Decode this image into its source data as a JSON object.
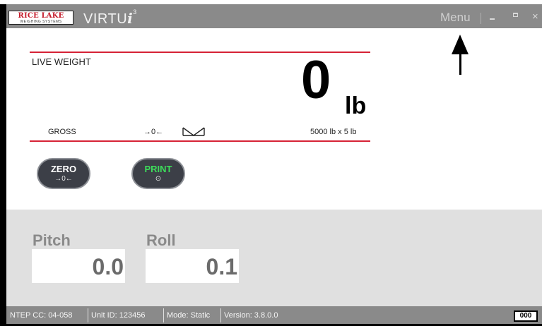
{
  "titlebar": {
    "logo_text": "RICE LAKE",
    "logo_subtext": "WEIGHING SYSTEMS",
    "brand_name": "VIRTU",
    "brand_i": "i",
    "brand_sup": "3",
    "menu_label": "Menu",
    "minimize_glyph": "minimize-icon",
    "maximize_glyph": "maximize-icon",
    "close_glyph": "×"
  },
  "live_weight": {
    "label": "LIVE WEIGHT",
    "value": "0",
    "unit": "lb",
    "mode": "GROSS",
    "center_of_zero_glyph": "→0←",
    "capacity": "5000 lb x 5 lb"
  },
  "buttons": {
    "zero": {
      "label": "ZERO",
      "icon_text": "→0←"
    },
    "print": {
      "label": "PRINT",
      "icon_text": "⊙"
    }
  },
  "tilt": {
    "pitch_label": "Pitch",
    "pitch_value": "0.0",
    "roll_label": "Roll",
    "roll_value": "0.1"
  },
  "status_bar": {
    "ntep": "NTEP CC: 04-058",
    "unit_id": "Unit ID: 123456",
    "mode": "Mode: Static",
    "version": "Version: 3.8.0.0",
    "indicator": "000"
  },
  "colors": {
    "accent_red": "#d62236",
    "titlebar_gray": "#8a8a8a",
    "print_green": "#3ddc5a",
    "button_dark": "#3c3f47"
  }
}
